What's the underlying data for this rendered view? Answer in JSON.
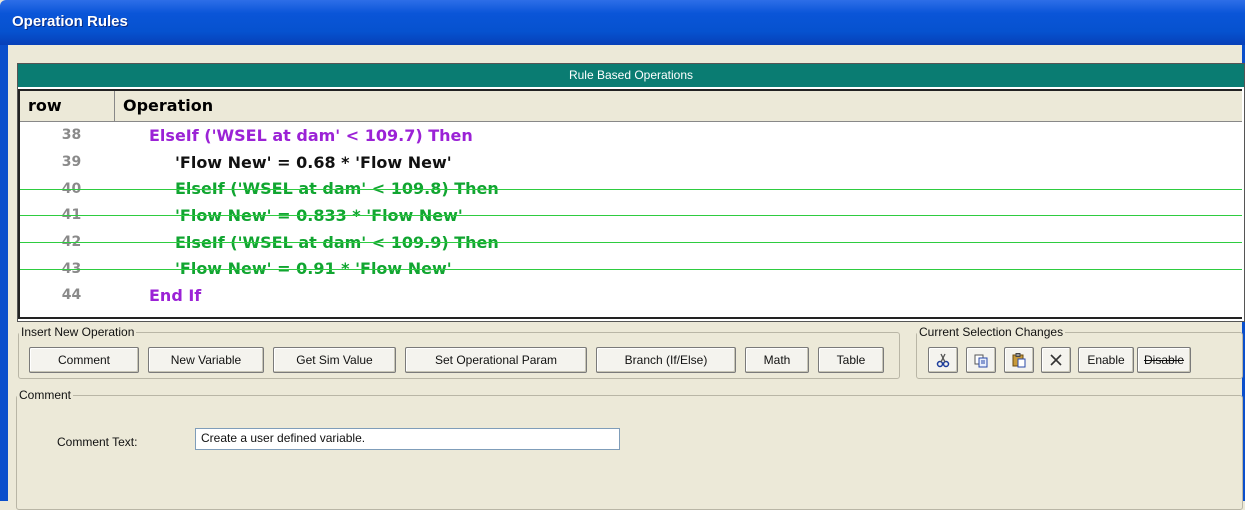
{
  "window": {
    "title": "Operation Rules"
  },
  "grid": {
    "caption": "Rule Based Operations",
    "headers": {
      "row": "row",
      "operation": "Operation"
    },
    "rows": [
      {
        "row": "38",
        "op": "ElseIf ('WSEL at dam' < 109.7) Then",
        "color": "#9b22d6",
        "indent": 1,
        "disabled": false
      },
      {
        "row": "39",
        "op": "'Flow New' = 0.68 * 'Flow New'",
        "color": "#111111",
        "indent": 2,
        "disabled": false
      },
      {
        "row": "40",
        "op": "ElseIf ('WSEL at dam' < 109.8) Then",
        "color": "#11a531",
        "indent": 2,
        "disabled": true
      },
      {
        "row": "41",
        "op": "'Flow New' = 0.833 * 'Flow New'",
        "color": "#11a531",
        "indent": 2,
        "disabled": true
      },
      {
        "row": "42",
        "op": "ElseIf ('WSEL at dam' < 109.9) Then",
        "color": "#11a531",
        "indent": 2,
        "disabled": true
      },
      {
        "row": "43",
        "op": "'Flow New' = 0.91 * 'Flow New'",
        "color": "#11a531",
        "indent": 2,
        "disabled": true
      },
      {
        "row": "44",
        "op": "End If",
        "color": "#9b22d6",
        "indent": 1,
        "disabled": false
      }
    ]
  },
  "insert_group": {
    "legend": "Insert New Operation",
    "buttons": {
      "comment": "Comment",
      "new_variable": "New Variable",
      "get_sim_value": "Get Sim Value",
      "set_operational_param": "Set Operational Param",
      "branch": "Branch (If/Else)",
      "math": "Math",
      "table": "Table"
    }
  },
  "selection_group": {
    "legend": "Current Selection Changes",
    "icons": [
      "cut-icon",
      "copy-icon",
      "paste-icon",
      "delete-icon"
    ],
    "enable": "Enable",
    "disable": "Disable"
  },
  "comment_group": {
    "legend": "Comment",
    "label": "Comment Text:",
    "value": "Create a user defined variable."
  }
}
